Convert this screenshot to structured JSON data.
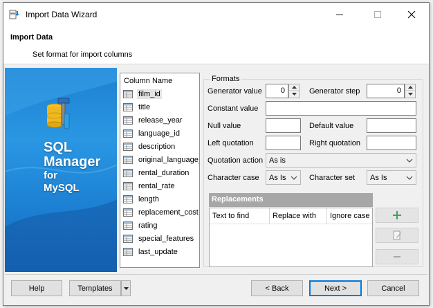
{
  "window": {
    "title": "Import Data Wizard",
    "controls": [
      "minimize",
      "maximize",
      "close"
    ]
  },
  "header": {
    "title": "Import Data",
    "subtitle": "Set format for import columns"
  },
  "banner": {
    "line1": "SQL",
    "line2": "Manager",
    "line3": "for",
    "line4": "MySQL"
  },
  "columns": {
    "header": "Column Name",
    "selected_index": 0,
    "items": [
      "film_id",
      "title",
      "release_year",
      "language_id",
      "description",
      "original_language_",
      "rental_duration",
      "rental_rate",
      "length",
      "replacement_cost",
      "rating",
      "special_features",
      "last_update"
    ]
  },
  "formats": {
    "legend": "Formats",
    "generator_value_label": "Generator value",
    "generator_value": "0",
    "generator_step_label": "Generator step",
    "generator_step": "0",
    "constant_value_label": "Constant value",
    "constant_value": "",
    "null_value_label": "Null value",
    "null_value": "",
    "default_value_label": "Default value",
    "default_value": "",
    "left_quotation_label": "Left quotation",
    "left_quotation": "",
    "right_quotation_label": "Right quotation",
    "right_quotation": "",
    "quotation_action_label": "Quotation action",
    "quotation_action": "As is",
    "character_case_label": "Character case",
    "character_case": "As Is",
    "character_set_label": "Character set",
    "character_set": "As Is"
  },
  "replacements": {
    "title": "Replacements",
    "columns": [
      "Text to find",
      "Replace with",
      "Ignore case"
    ],
    "rows": []
  },
  "footer": {
    "help": "Help",
    "templates": "Templates",
    "back": "< Back",
    "next": "Next >",
    "cancel": "Cancel"
  },
  "colors": {
    "banner_blue": "#1d7fd0",
    "default_button_border": "#0078d7",
    "replacements_header": "#a7a7a7"
  }
}
